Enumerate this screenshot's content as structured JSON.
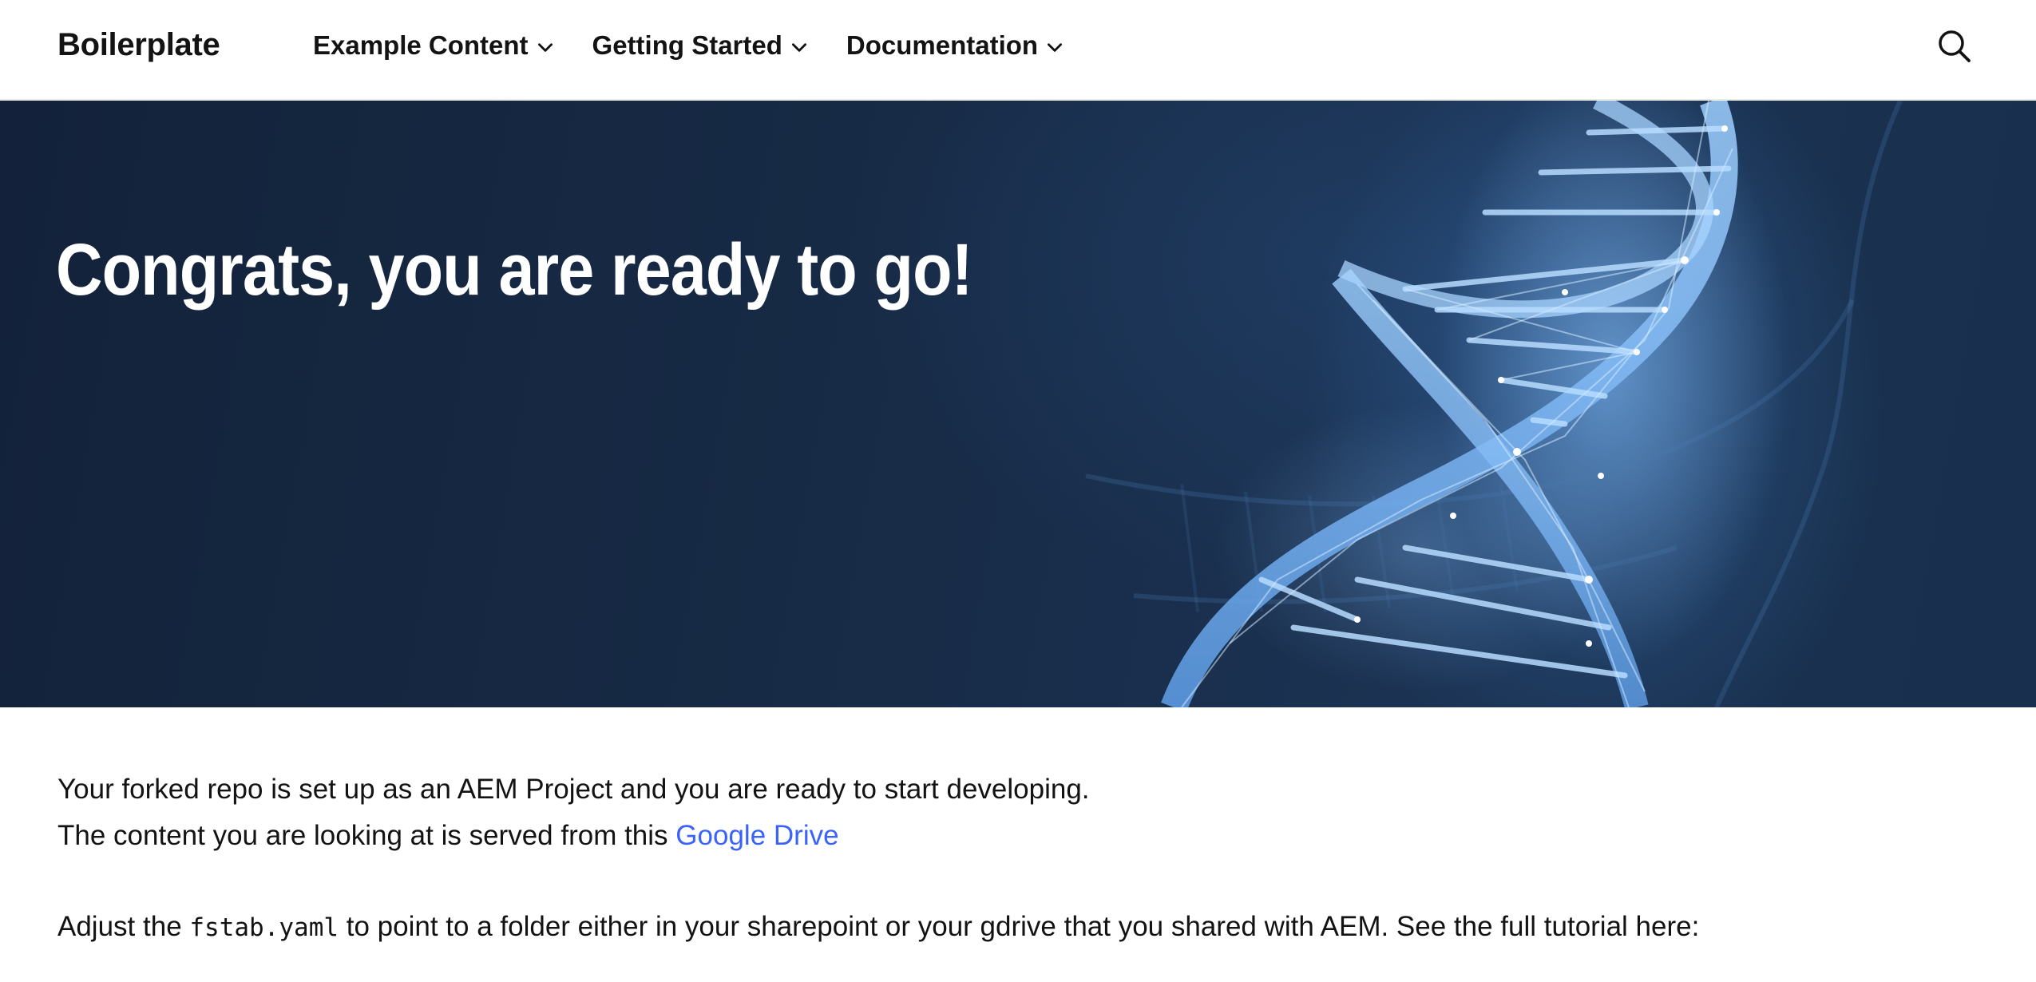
{
  "header": {
    "brand": "Boilerplate",
    "nav": [
      {
        "label": "Example Content",
        "icon": "chevron-down-icon"
      },
      {
        "label": "Getting Started",
        "icon": "chevron-down-icon"
      },
      {
        "label": "Documentation",
        "icon": "chevron-down-icon"
      }
    ],
    "search_icon": "search-icon"
  },
  "hero": {
    "title": "Congrats, you are ready to go!",
    "image": "dna-helix-image"
  },
  "content": {
    "line1": "Your forked repo is set up as an AEM Project and you are ready to start developing.",
    "line2_prefix": "The content you are looking at is served from this",
    "line2_link": "Google Drive",
    "line3_prefix": "Adjust the",
    "line3_code": "fstab.yaml",
    "line3_suffix": "to point to a folder either in your sharepoint or your gdrive that you shared with AEM. See the full tutorial here:"
  },
  "colors": {
    "link": "#3b63fb",
    "hero_bg": "#172a45",
    "text": "#131313"
  }
}
